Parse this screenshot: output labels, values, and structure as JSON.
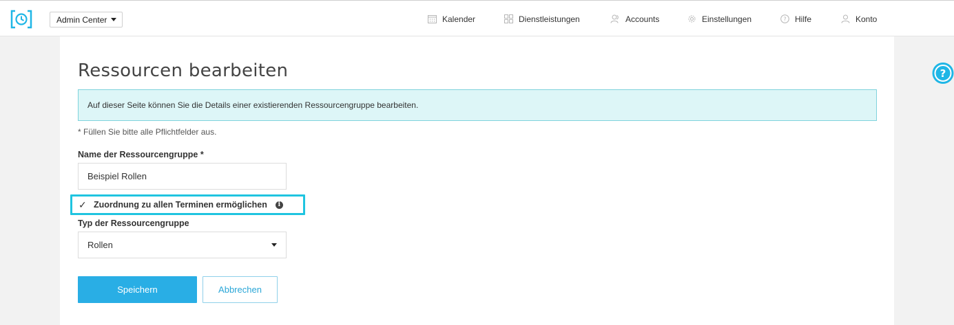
{
  "header": {
    "admin_select": "Admin Center",
    "nav": [
      {
        "label": "Kalender",
        "icon": "calendar-icon"
      },
      {
        "label": "Dienstleistungen",
        "icon": "grid-icon"
      },
      {
        "label": "Accounts",
        "icon": "users-icon"
      },
      {
        "label": "Einstellungen",
        "icon": "gear-icon"
      },
      {
        "label": "Hilfe",
        "icon": "help-circle-icon"
      },
      {
        "label": "Konto",
        "icon": "user-icon"
      }
    ]
  },
  "page": {
    "title": "Ressourcen bearbeiten",
    "info": "Auf dieser Seite können Sie die Details einer existierenden Ressourcengruppe bearbeiten.",
    "required_note": "* Füllen Sie bitte alle Pflichtfelder aus.",
    "name_label": "Name der Ressourcengruppe *",
    "name_value": "Beispiel Rollen",
    "checkbox_label": "Zuordnung zu allen Terminen ermöglichen",
    "checkbox_checked": true,
    "checkbox_mark": "✓",
    "type_label": "Typ der Ressourcengruppe",
    "type_value": "Rollen",
    "save_label": "Speichern",
    "cancel_label": "Abbrechen"
  },
  "colors": {
    "accent": "#29aee5",
    "highlight": "#1fc4e0",
    "info_bg": "#ddf6f7"
  }
}
